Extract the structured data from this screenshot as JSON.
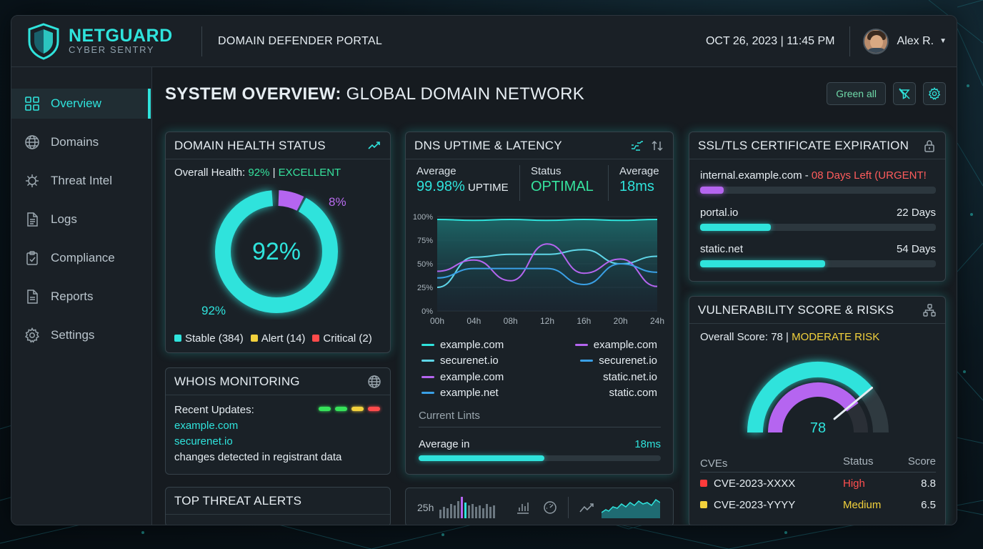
{
  "brand": {
    "name": "NETGUARD",
    "tagline": "CYBER SENTRY"
  },
  "header": {
    "portal_title": "DOMAIN DEFENDER PORTAL",
    "datetime": "OCT 26, 2023 | 11:45 PM",
    "user_name": "Alex R."
  },
  "sidebar": {
    "items": [
      {
        "label": "Overview",
        "icon": "grid-icon",
        "active": true
      },
      {
        "label": "Domains",
        "icon": "globe-icon"
      },
      {
        "label": "Threat Intel",
        "icon": "virus-icon"
      },
      {
        "label": "Logs",
        "icon": "document-icon"
      },
      {
        "label": "Compliance",
        "icon": "clipboard-icon"
      },
      {
        "label": "Reports",
        "icon": "report-icon"
      },
      {
        "label": "Settings",
        "icon": "gear-icon"
      }
    ]
  },
  "page": {
    "title_bold": "SYSTEM OVERVIEW:",
    "title_rest": " GLOBAL DOMAIN NETWORK",
    "green_all_label": "Green all"
  },
  "health": {
    "title": "DOMAIN HEALTH STATUS",
    "overall_label": "Overall Health:",
    "overall_value": "92%",
    "overall_sep": "|",
    "overall_status": "EXCELLENT",
    "center_label": "92%",
    "left_label": "92%",
    "right_label": "8%",
    "healthy_fraction": 0.92,
    "legend": [
      {
        "label": "Stable (384)",
        "color": "#2fe3dc"
      },
      {
        "label": "Alert (14)",
        "color": "#f2d13c"
      },
      {
        "label": "Critical (2)",
        "color": "#ff4b4b"
      }
    ]
  },
  "whois": {
    "title": "WHOIS MONITORING",
    "recent_label": "Recent Updates:",
    "domains": [
      "example.com",
      "securenet.io"
    ],
    "changes": "changes detected in registrant data",
    "status_colors": [
      "#36e35a",
      "#36e35a",
      "#f2d13c",
      "#ff4b4b"
    ]
  },
  "threats": {
    "title": "TOP THREAT ALERTS"
  },
  "dns": {
    "title": "DNS UPTIME & LATENCY",
    "stats": [
      {
        "label": "Average",
        "value": "99.98%",
        "unit": " UPTIME"
      },
      {
        "label": "Status",
        "value": "OPTIMAL",
        "unit": ""
      },
      {
        "label": "Average",
        "value": "18ms",
        "unit": ""
      }
    ],
    "legend_left": [
      "example.com",
      "securenet.io",
      "example.com",
      "example.net"
    ],
    "legend_right": [
      "example.com",
      "securenet.io",
      "static.net.io",
      "static.com"
    ],
    "current_lints": "Current Lints",
    "average_in": "Average in",
    "average_in_value": "18ms",
    "average_in_fraction": 0.52,
    "mini_label": "25h"
  },
  "chart_data": {
    "type": "line",
    "x": [
      "00h",
      "04h",
      "08h",
      "12h",
      "16h",
      "20h",
      "24h"
    ],
    "y_ticks": [
      "0%",
      "25%",
      "50%",
      "75%",
      "100%"
    ],
    "ylim": [
      0,
      100
    ],
    "series": [
      {
        "name": "example.com",
        "color": "#2fe3dc",
        "values": [
          97,
          96,
          97,
          96,
          97,
          96,
          97
        ]
      },
      {
        "name": "securenet.io",
        "color": "#5fd6e8",
        "values": [
          25,
          57,
          60,
          60,
          65,
          50,
          58
        ]
      },
      {
        "name": "example.com",
        "color": "#b565f0",
        "values": [
          42,
          54,
          32,
          71,
          40,
          55,
          26
        ]
      },
      {
        "name": "example.net",
        "color": "#3aa0e6",
        "values": [
          35,
          45,
          45,
          45,
          28,
          50,
          41
        ]
      }
    ]
  },
  "ssl": {
    "title": "SSL/TLS CERTIFICATE EXPIRATION",
    "rows": [
      {
        "domain": "internal.example.com",
        "sep": "-",
        "days": "08 Days Left (URGENT!",
        "fraction": 0.1,
        "color": "#b565f0",
        "urgent": true
      },
      {
        "domain": "portal.io",
        "sep": "",
        "days": "22 Days",
        "fraction": 0.3,
        "color": "#2fe3dc",
        "urgent": false
      },
      {
        "domain": "static.net",
        "sep": "",
        "days": "54 Days",
        "fraction": 0.53,
        "color": "#2fe3dc",
        "urgent": false
      }
    ]
  },
  "vuln": {
    "title": "VULNERABILITY SCORE & RISKS",
    "score_label": "Overall Score: 78 |",
    "risk": "MODERATE RISK",
    "gauge_value": "78",
    "gauge_fraction": 0.78,
    "cve_headers": [
      "CVEs",
      "Status",
      "Score"
    ],
    "cves": [
      {
        "id": "CVE-2023-XXXX",
        "status": "High",
        "score": "8.8",
        "color": "#ff3b3b"
      },
      {
        "id": "CVE-2023-YYYY",
        "status": "Medium",
        "score": "6.5",
        "color": "#f2d13c"
      }
    ]
  }
}
